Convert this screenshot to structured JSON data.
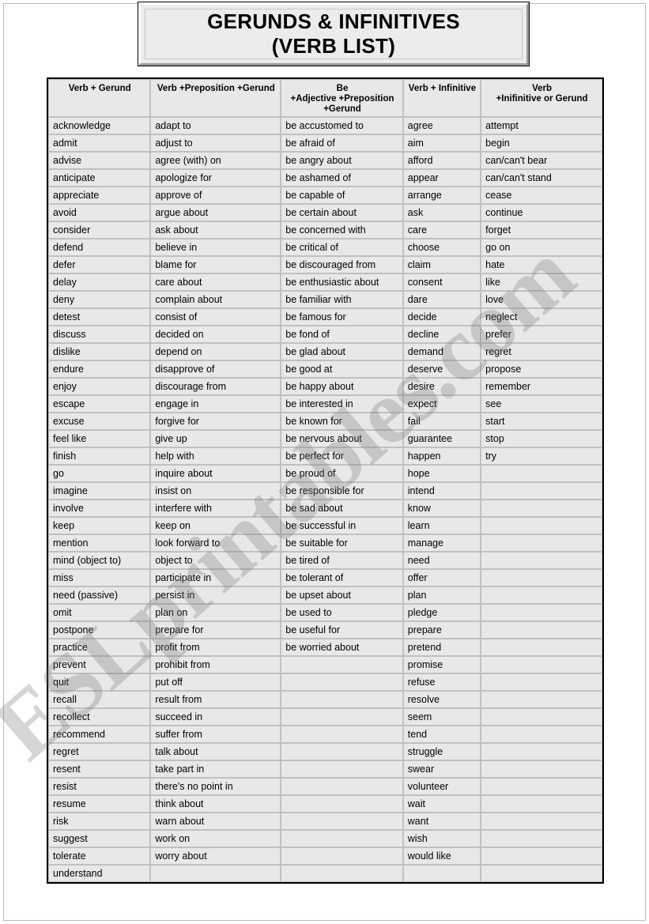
{
  "document": {
    "title_line_1": "GERUNDS & INFINITIVES",
    "title_line_2": "(VERB LIST)",
    "watermark": "ESLprintables.com"
  },
  "table": {
    "headers": [
      "Verb + Gerund",
      "Verb +Preposition +Gerund",
      "Be\n+Adjective +Preposition\n+Gerund",
      "Verb + Infinitive",
      "Verb\n+Inifinitive or Gerund"
    ],
    "header_lines": {
      "col3": [
        "Be",
        "+Adjective +Preposition",
        "+Gerund"
      ],
      "col5": [
        "Verb",
        "+Inifinitive or Gerund"
      ]
    },
    "columns": {
      "verb_gerund": [
        "acknowledge",
        "admit",
        "advise",
        "anticipate",
        "appreciate",
        "avoid",
        "consider",
        "defend",
        "defer",
        "delay",
        "deny",
        "detest",
        "discuss",
        "dislike",
        "endure",
        "enjoy",
        "escape",
        "excuse",
        "feel like",
        "finish",
        "go",
        "imagine",
        "involve",
        "keep",
        "mention",
        "mind (object to)",
        "miss",
        "need (passive)",
        "omit",
        "postpone",
        "practice",
        "prevent",
        "quit",
        "recall",
        "recollect",
        "recommend",
        "regret",
        "resent",
        "resist",
        "resume",
        "risk",
        "suggest",
        "tolerate",
        "understand"
      ],
      "verb_preposition_gerund": [
        "adapt to",
        "adjust to",
        "agree (with) on",
        " apologize for",
        "approve of",
        "argue about",
        "ask about",
        "believe in",
        "blame for",
        "care about",
        "complain about",
        "consist of",
        "decided on",
        "depend on",
        "disapprove of",
        "discourage from",
        "engage in",
        "forgive for",
        "give up",
        "help with",
        "inquire about",
        "insist on",
        "interfere with",
        "keep on",
        "look forward to",
        "object to",
        "participate in",
        "persist in",
        "plan on",
        "prepare for",
        "profit from",
        "prohibit from",
        "put off",
        "result from",
        "succeed in",
        "suffer from",
        "talk about",
        "take part in",
        "there's no point in",
        "think about",
        "warn about",
        "work on",
        "worry about",
        ""
      ],
      "be_adjective_preposition_gerund": [
        "be accustomed to",
        "be afraid of",
        "be angry about",
        "be ashamed of",
        "be capable of",
        "be certain about",
        "be concerned with",
        "be critical of",
        "be discouraged from",
        "be enthusiastic about",
        "be familiar with",
        "be famous for",
        "be fond of",
        "be glad about",
        "be good at",
        "be happy about",
        "be interested in",
        "be known for",
        "be nervous about",
        "be perfect for",
        "be proud of",
        "be responsible for",
        "be sad about",
        "be successful in",
        "be suitable for",
        "be tired of",
        "be tolerant of",
        "be upset about",
        "be used to",
        "be useful for",
        "be worried about",
        "",
        "",
        "",
        "",
        "",
        "",
        "",
        "",
        "",
        "",
        "",
        "",
        ""
      ],
      "verb_infinitive": [
        "agree",
        "aim",
        "afford",
        "appear",
        "arrange",
        "ask",
        "care",
        "choose",
        "claim",
        "consent",
        "dare",
        "decide",
        "decline",
        "demand",
        "deserve",
        "desire",
        "expect",
        "fail",
        "guarantee",
        "happen",
        "hope",
        "intend",
        "know",
        "learn",
        "manage",
        "need",
        "offer",
        "plan",
        "pledge",
        "prepare",
        "pretend",
        "promise",
        "refuse",
        "resolve",
        "seem",
        "tend",
        "struggle",
        "swear",
        "volunteer",
        "wait",
        "want",
        "wish",
        "would like",
        ""
      ],
      "verb_infinitive_or_gerund": [
        "attempt",
        "begin",
        "can/can't bear",
        "can/can't stand",
        "cease",
        "continue",
        "forget",
        "go on",
        "hate",
        "like",
        "love",
        "neglect",
        "prefer",
        "regret",
        "propose",
        "remember",
        "see",
        "start",
        "stop",
        "try",
        "",
        "",
        "",
        "",
        "",
        "",
        "",
        "",
        "",
        "",
        "",
        "",
        "",
        "",
        "",
        "",
        "",
        "",
        "",
        "",
        "",
        "",
        "",
        ""
      ]
    },
    "row_count": 44
  }
}
